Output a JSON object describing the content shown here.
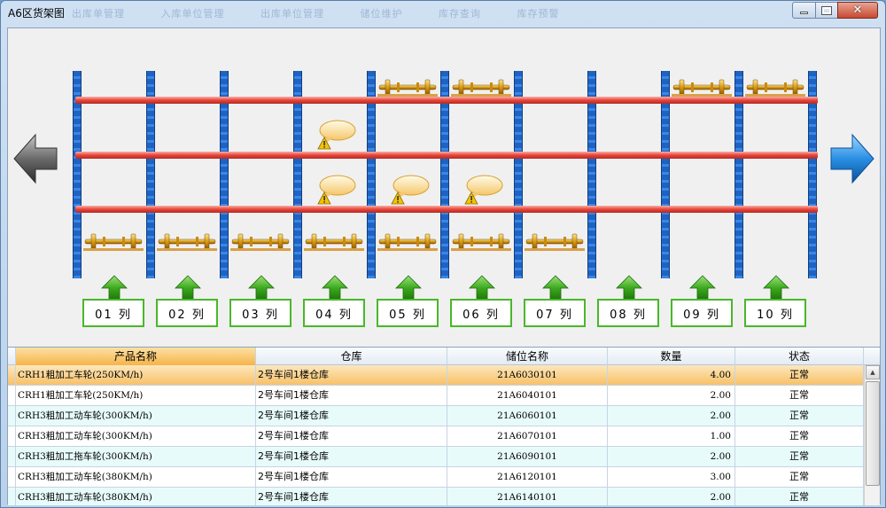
{
  "window": {
    "title": "A6区货架图",
    "ghost_menu": [
      "出库单管理",
      "入库单位管理",
      "出库单位管理",
      "储位维护",
      "库存查询",
      "库存预警"
    ]
  },
  "rack": {
    "columns": [
      "01 列",
      "02 列",
      "03 列",
      "04 列",
      "05 列",
      "06 列",
      "07 列",
      "08 列",
      "09 列",
      "10 列"
    ],
    "colors": {
      "post": "#1f63c2",
      "beam": "#e8453a",
      "arrow": "#3aa81c",
      "box_border": "#4ab72a"
    }
  },
  "grid": {
    "headers": [
      "产品名称",
      "仓库",
      "储位名称",
      "数量",
      "状态"
    ],
    "rows": [
      [
        "CRH1粗加工车轮(250KM/h)",
        "2号车间1楼仓库",
        "21A6030101",
        "4.00",
        "正常"
      ],
      [
        "CRH1粗加工车轮(250KM/h)",
        "2号车间1楼仓库",
        "21A6040101",
        "2.00",
        "正常"
      ],
      [
        "CRH3粗加工动车轮(300KM/h)",
        "2号车间1楼仓库",
        "21A6060101",
        "2.00",
        "正常"
      ],
      [
        "CRH3粗加工动车轮(300KM/h)",
        "2号车间1楼仓库",
        "21A6070101",
        "1.00",
        "正常"
      ],
      [
        "CRH3粗加工拖车轮(300KM/h)",
        "2号车间1楼仓库",
        "21A6090101",
        "2.00",
        "正常"
      ],
      [
        "CRH3粗加工动车轮(380KM/h)",
        "2号车间1楼仓库",
        "21A6120101",
        "3.00",
        "正常"
      ],
      [
        "CRH3粗加工动车轮(380KM/h)",
        "2号车间1楼仓库",
        "21A6140101",
        "2.00",
        "正常"
      ]
    ],
    "selected_row": 0
  }
}
